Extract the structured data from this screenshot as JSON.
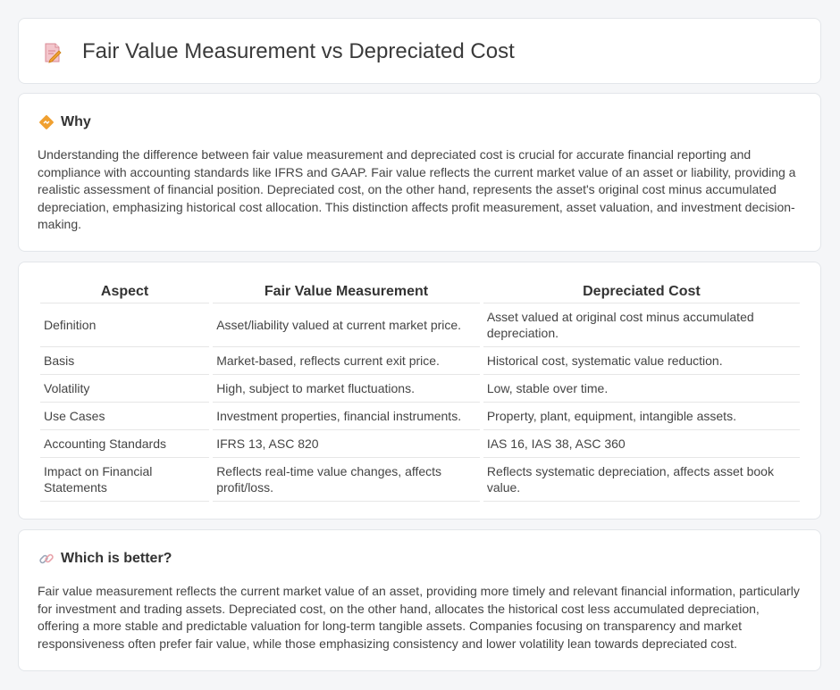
{
  "header": {
    "title": "Fair Value Measurement vs Depreciated Cost",
    "icon": "document-pencil-icon"
  },
  "why": {
    "icon": "diamond-signpost-icon",
    "title": "Why",
    "text": "Understanding the difference between fair value measurement and depreciated cost is crucial for accurate financial reporting and compliance with accounting standards like IFRS and GAAP. Fair value reflects the current market value of an asset or liability, providing a realistic assessment of financial position. Depreciated cost, on the other hand, represents the asset's original cost minus accumulated depreciation, emphasizing historical cost allocation. This distinction affects profit measurement, asset valuation, and investment decision-making."
  },
  "comparison": {
    "headers": [
      "Aspect",
      "Fair Value Measurement",
      "Depreciated Cost"
    ],
    "rows": [
      [
        "Definition",
        "Asset/liability valued at current market price.",
        "Asset valued at original cost minus accumulated depreciation."
      ],
      [
        "Basis",
        "Market-based, reflects current exit price.",
        "Historical cost, systematic value reduction."
      ],
      [
        "Volatility",
        "High, subject to market fluctuations.",
        "Low, stable over time."
      ],
      [
        "Use Cases",
        "Investment properties, financial instruments.",
        "Property, plant, equipment, intangible assets."
      ],
      [
        "Accounting Standards",
        "IFRS 13, ASC 820",
        "IAS 16, IAS 38, ASC 360"
      ],
      [
        "Impact on Financial Statements",
        "Reflects real-time value changes, affects profit/loss.",
        "Reflects systematic depreciation, affects asset book value."
      ]
    ]
  },
  "better": {
    "icon": "link-icon",
    "title": "Which is better?",
    "text": "Fair value measurement reflects the current market value of an asset, providing more timely and relevant financial information, particularly for investment and trading assets. Depreciated cost, on the other hand, allocates the historical cost less accumulated depreciation, offering a more stable and predictable valuation for long-term tangible assets. Companies focusing on transparency and market responsiveness often prefer fair value, while those emphasizing consistency and lower volatility lean towards depreciated cost."
  },
  "colors": {
    "background": "#f5f6f8",
    "card": "#ffffff",
    "accent_orange": "#f0a030",
    "accent_pink": "#e8a0a8"
  }
}
